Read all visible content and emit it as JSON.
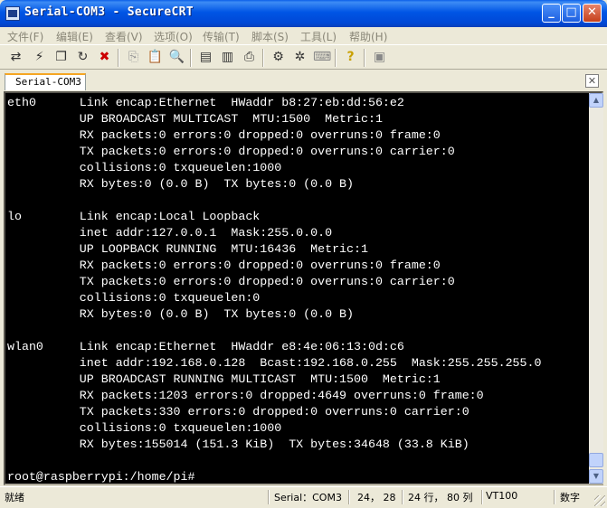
{
  "window": {
    "title": "Serial-COM3 - SecureCRT"
  },
  "menu": {
    "items": [
      "文件(F)",
      "编辑(E)",
      "查看(V)",
      "选项(O)",
      "传输(T)",
      "脚本(S)",
      "工具(L)",
      "帮助(H)"
    ]
  },
  "toolbar": {
    "buttons": [
      "connect-icon",
      "quick-connect-icon",
      "connect-in-tab-icon",
      "reconnect-icon",
      "disconnect-icon",
      "copy-icon",
      "paste-icon",
      "find-icon",
      "print-screen-icon",
      "print-selection-icon",
      "print-icon",
      "session-options-icon",
      "global-options-icon",
      "keymap-icon",
      "help-icon",
      "sftp-icon"
    ]
  },
  "tab": {
    "label": "Serial-COM3"
  },
  "terminal": {
    "lines": [
      "eth0      Link encap:Ethernet  HWaddr b8:27:eb:dd:56:e2",
      "          UP BROADCAST MULTICAST  MTU:1500  Metric:1",
      "          RX packets:0 errors:0 dropped:0 overruns:0 frame:0",
      "          TX packets:0 errors:0 dropped:0 overruns:0 carrier:0",
      "          collisions:0 txqueuelen:1000",
      "          RX bytes:0 (0.0 B)  TX bytes:0 (0.0 B)",
      "",
      "lo        Link encap:Local Loopback",
      "          inet addr:127.0.0.1  Mask:255.0.0.0",
      "          UP LOOPBACK RUNNING  MTU:16436  Metric:1",
      "          RX packets:0 errors:0 dropped:0 overruns:0 frame:0",
      "          TX packets:0 errors:0 dropped:0 overruns:0 carrier:0",
      "          collisions:0 txqueuelen:0",
      "          RX bytes:0 (0.0 B)  TX bytes:0 (0.0 B)",
      "",
      "wlan0     Link encap:Ethernet  HWaddr e8:4e:06:13:0d:c6",
      "          inet addr:192.168.0.128  Bcast:192.168.0.255  Mask:255.255.255.0",
      "          UP BROADCAST RUNNING MULTICAST  MTU:1500  Metric:1",
      "          RX packets:1203 errors:0 dropped:4649 overruns:0 frame:0",
      "          TX packets:330 errors:0 dropped:0 overruns:0 carrier:0",
      "          collisions:0 txqueuelen:1000",
      "          RX bytes:155014 (151.3 KiB)  TX bytes:34648 (33.8 KiB)",
      "",
      "root@raspberrypi:/home/pi#"
    ]
  },
  "status": {
    "ready": "就绪",
    "session": "Serial：COM3",
    "cursor": "24， 28",
    "size": "24 行， 80 列",
    "terminal_type": "VT100",
    "numlock": "数字"
  },
  "colors": {
    "terminal_bg": "#000000",
    "terminal_fg": "#ffffff",
    "title_bar": "#0055e5",
    "chrome": "#ece9d8"
  }
}
